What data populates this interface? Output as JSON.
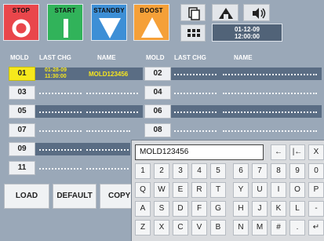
{
  "mode_buttons": [
    {
      "label": "STOP"
    },
    {
      "label": "START"
    },
    {
      "label": "STANDBY"
    },
    {
      "label": "BOOST"
    }
  ],
  "clock": {
    "date": "01-12-09",
    "time": "12:00:00"
  },
  "columns": {
    "mold": "MOLD",
    "last_chg": "LAST CHG",
    "name": "NAME"
  },
  "left_rows": [
    {
      "mold": "01",
      "date": "01-28-09",
      "time": "11:30:00",
      "name": "MOLD123456"
    },
    {
      "mold": "03"
    },
    {
      "mold": "05"
    },
    {
      "mold": "07"
    },
    {
      "mold": "09"
    },
    {
      "mold": "11"
    }
  ],
  "right_rows": [
    {
      "mold": "02"
    },
    {
      "mold": "04"
    },
    {
      "mold": "06"
    },
    {
      "mold": "08"
    }
  ],
  "bottom_buttons": {
    "load": "LOAD",
    "default": "DEFAULT",
    "copy": "COPY"
  },
  "keyboard": {
    "input_value": "MOLD123456",
    "control_keys": [
      "←",
      "|←",
      "X"
    ],
    "rows": [
      [
        "1",
        "2",
        "3",
        "4",
        "5",
        "6",
        "7",
        "8",
        "9",
        "0"
      ],
      [
        "Q",
        "W",
        "E",
        "R",
        "T",
        "Y",
        "U",
        "I",
        "O",
        "P"
      ],
      [
        "A",
        "S",
        "D",
        "F",
        "G",
        "H",
        "J",
        "K",
        "L",
        "-"
      ],
      [
        "Z",
        "X",
        "C",
        "V",
        "B",
        "N",
        "M",
        "#",
        "."
      ]
    ],
    "enter_key": "↵"
  },
  "colors": {
    "stop": "#e9464b",
    "start": "#31b35a",
    "standby": "#3d8fd6",
    "boost": "#f5a038",
    "selected": "#f6e81c",
    "panel": "#9aa8b8"
  }
}
